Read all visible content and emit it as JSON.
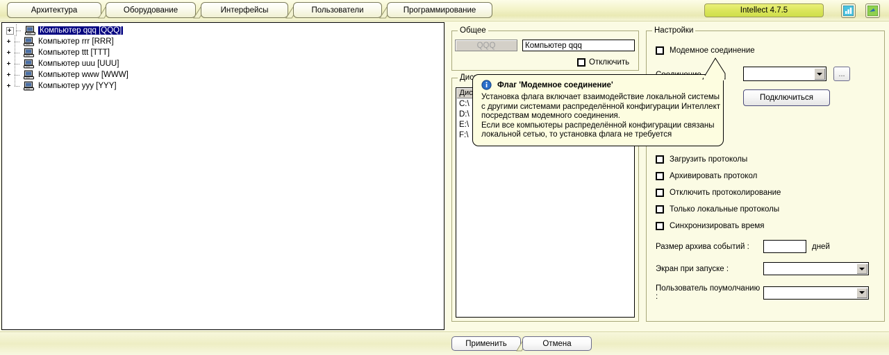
{
  "window": {
    "version_badge": "Intellect 4.7.5"
  },
  "tabs": [
    {
      "label": "Архитектура",
      "active": true
    },
    {
      "label": "Оборудование",
      "active": false
    },
    {
      "label": "Интерфейсы",
      "active": false
    },
    {
      "label": "Пользователи",
      "active": false
    },
    {
      "label": "Программирование",
      "active": false
    }
  ],
  "toolbar_icons": [
    {
      "name": "chart-icon",
      "color": "#49c2e0"
    },
    {
      "name": "check-arrow-icon",
      "color": "#6cc24a"
    }
  ],
  "tree": {
    "items": [
      {
        "label": "Компьютер qqq [QQQ]",
        "selected": true,
        "expandable": true
      },
      {
        "label": "Компьютер rrr [RRR]",
        "selected": false,
        "expandable": false
      },
      {
        "label": "Компьютер ttt [TTT]",
        "selected": false,
        "expandable": false
      },
      {
        "label": "Компьютер uuu [UUU]",
        "selected": false,
        "expandable": false
      },
      {
        "label": "Компьютер www [WWW]",
        "selected": false,
        "expandable": false
      },
      {
        "label": "Компьютер yyy [YYY]",
        "selected": false,
        "expandable": false
      }
    ]
  },
  "general_group": {
    "title": "Общее",
    "id_field_value": "QQQ",
    "name_field_value": "Компьютер qqq",
    "disable_checkbox": {
      "label": "Отключить",
      "checked": false
    }
  },
  "disks_group": {
    "title": "Диски",
    "column_header": "Диск",
    "rows": [
      "C:\\",
      "D:\\",
      "E:\\",
      "F:\\"
    ]
  },
  "settings_group": {
    "title": "Настройки",
    "modem_checkbox": {
      "label": "Модемное соединение",
      "checked": false
    },
    "connection_label": "Соединение",
    "connection_combo_value": "",
    "browse_button": "...",
    "connect_button": "Подключиться",
    "checkboxes": [
      {
        "label": "Загрузить протоколы",
        "checked": false
      },
      {
        "label": "Архивировать протокол",
        "checked": false
      },
      {
        "label": "Отключить протоколирование",
        "checked": false
      },
      {
        "label": "Только локальные протоколы",
        "checked": false
      },
      {
        "label": "Синхронизировать время",
        "checked": false
      }
    ],
    "archive_size": {
      "label": "Размер архива событий :",
      "value": "",
      "unit": "дней"
    },
    "startup_screen": {
      "label": "Экран при запуске :",
      "value": ""
    },
    "default_user": {
      "label": "Пользователь поумолчанию :",
      "value": ""
    }
  },
  "tooltip": {
    "title": "Флаг 'Модемное соединение'",
    "lines": [
      "Установка флага включает взаимодействие локальной системы",
      "с другими системами распределённой конфигурации Интеллект",
      "посредствам модемного соединения.",
      "Если все компьютеры распределённой конфигурации связаны",
      "локальной сетью, то установка флага не требуется"
    ]
  },
  "footer": {
    "apply_button": "Применить",
    "cancel_button": "Отмена"
  },
  "colors": {
    "background": "#fbfbe4",
    "badge": "#dbe65c",
    "selection": "#000080"
  }
}
